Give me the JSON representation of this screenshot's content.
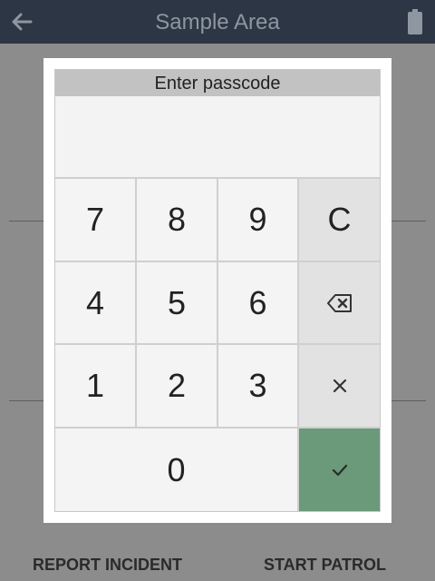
{
  "app_bar": {
    "title": "Sample Area",
    "back_icon": "arrow-left-icon",
    "battery_icon": "battery-icon"
  },
  "bottom_actions": {
    "report_incident": "REPORT INCIDENT",
    "start_patrol": "START PATROL"
  },
  "dialog": {
    "title": "Enter passcode",
    "passcode_value": "",
    "keys": {
      "k7": "7",
      "k8": "8",
      "k9": "9",
      "clear": "C",
      "k4": "4",
      "k5": "5",
      "k6": "6",
      "k1": "1",
      "k2": "2",
      "k3": "3",
      "k0": "0"
    },
    "icons": {
      "backspace": "backspace-icon",
      "cancel": "close-icon",
      "confirm": "check-icon"
    }
  },
  "colors": {
    "app_bar": "#2c3644",
    "overlay_background": "#8c8c8c",
    "confirm_key": "#6a9a7a",
    "function_key": "#e2e2e2"
  }
}
